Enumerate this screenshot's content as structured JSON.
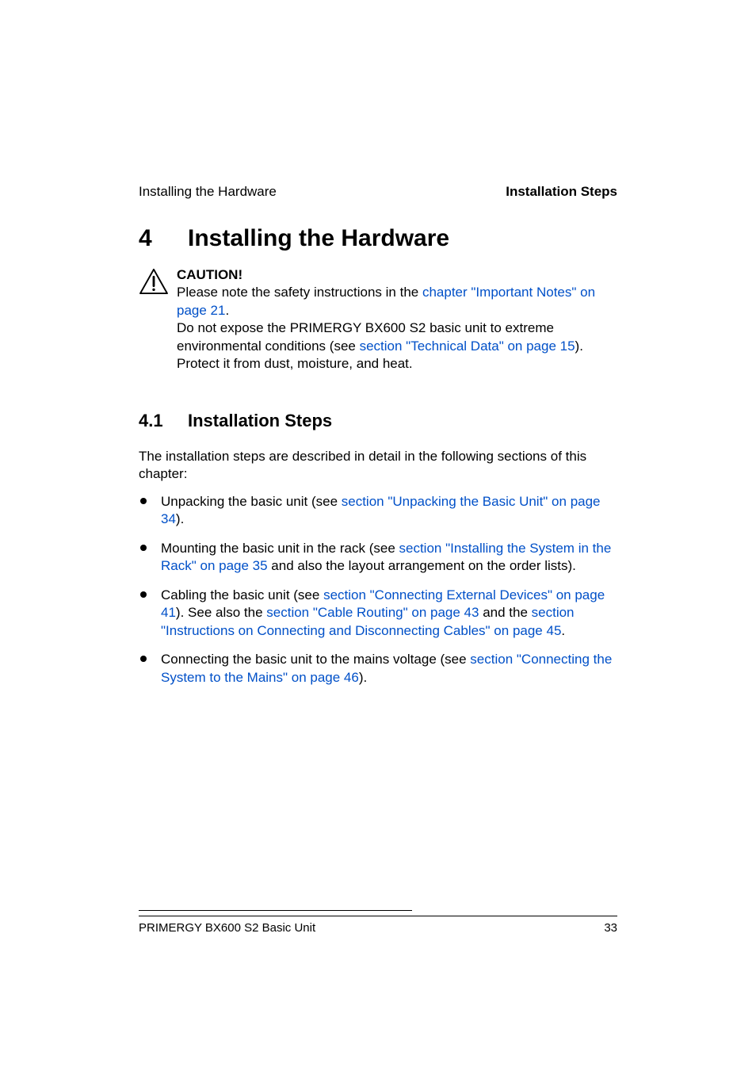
{
  "header": {
    "left": "Installing the Hardware",
    "right": "Installation Steps"
  },
  "h1": {
    "number": "4",
    "title": "Installing the Hardware"
  },
  "caution": {
    "label": "CAUTION!",
    "pre": "Please note the safety instructions in the ",
    "link1": "chapter \"Important Notes\" on page 21",
    "mid1": ".",
    "line2_pre": "Do not expose the PRIMERGY BX600 S2 basic unit to extreme environmental conditions (see ",
    "link2": "section \"Technical Data\" on page 15",
    "line2_post": "). Protect it from dust, moisture, and heat."
  },
  "h2": {
    "number": "4.1",
    "title": "Installation Steps"
  },
  "intro": "The installation steps are described in detail in the following sections of this chapter:",
  "bullets": {
    "b1_pre": "Unpacking the basic unit (see ",
    "b1_link": "section \"Unpacking the Basic Unit\" on page 34",
    "b1_post": ").",
    "b2_pre": "Mounting the basic unit in the rack (see ",
    "b2_link": "section \"Installing the System in the Rack\" on page 35",
    "b2_post": " and also the layout arrangement on the order lists).",
    "b3_pre": "Cabling the basic unit (see ",
    "b3_link1": "section \"Connecting External Devices\" on page 41",
    "b3_mid1": "). See also the ",
    "b3_link2": "section \"Cable Routing\" on page 43",
    "b3_mid2": " and the ",
    "b3_link3": "section \"Instructions on Connecting and Disconnecting Cables\" on page 45",
    "b3_post": ".",
    "b4_pre": "Connecting the basic unit to the mains voltage (see ",
    "b4_link": "section \"Connecting the System to the Mains\" on page 46",
    "b4_post": ")."
  },
  "footer": {
    "left": "PRIMERGY BX600 S2 Basic Unit",
    "right": "33"
  }
}
